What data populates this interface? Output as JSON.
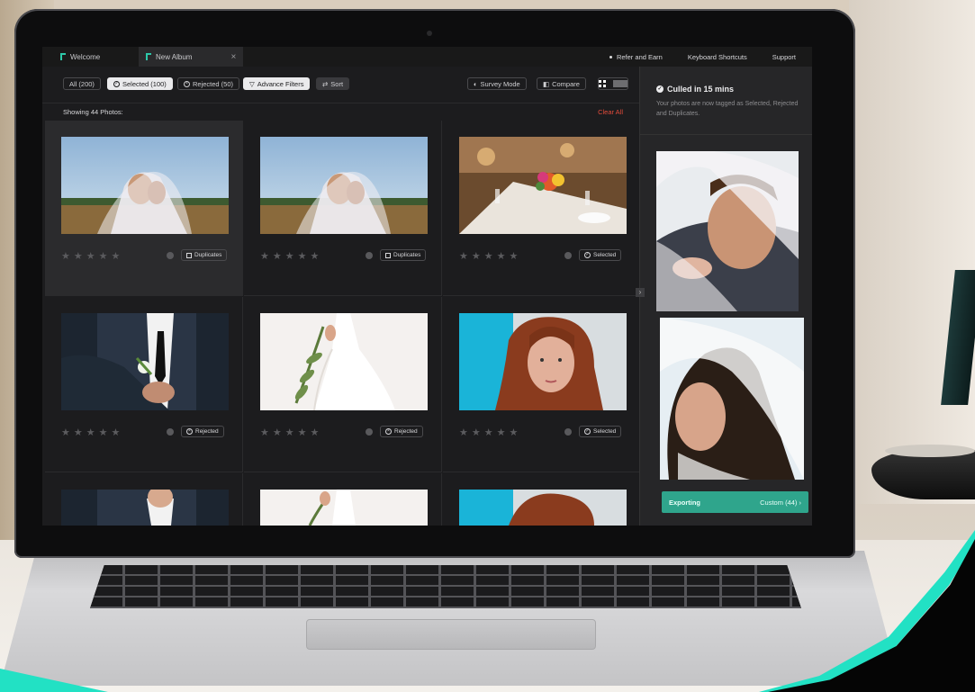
{
  "tabs": [
    {
      "label": "Welcome",
      "active": false
    },
    {
      "label": "New Album",
      "active": true
    }
  ],
  "top_links": [
    "Refer and Earn",
    "Keyboard Shortcuts",
    "Support"
  ],
  "filters": {
    "all": "All (200)",
    "selected": "Selected (100)",
    "rejected": "Rejected (50)",
    "advance": "Advance Filters",
    "sort": "Sort"
  },
  "toolbar_right": {
    "survey_mode": "Survey Mode",
    "compare": "Compare"
  },
  "showing_text": "Showing 44 Photos:",
  "clear_all": "Clear All",
  "photos": [
    {
      "tag": "Duplicates",
      "subject": "couple-field"
    },
    {
      "tag": "Duplicates",
      "subject": "couple-field"
    },
    {
      "tag": "Selected",
      "subject": "dinner-table"
    },
    {
      "tag": "Rejected",
      "subject": "groom-suit"
    },
    {
      "tag": "Rejected",
      "subject": "bride-dress"
    },
    {
      "tag": "Selected",
      "subject": "redhead-portrait"
    }
  ],
  "stars": "★★★★★",
  "side_panel": {
    "culled_title": "Culled in 15 mins",
    "culled_subtitle": "Your photos are now tagged as Selected, Rejected and Duplicates.",
    "export_label": "Exporting",
    "export_value": "Custom (44)"
  },
  "colors": {
    "accent": "#2fa58c",
    "clear_all": "#e24b3b",
    "corner_teal": "#22e1c4"
  }
}
